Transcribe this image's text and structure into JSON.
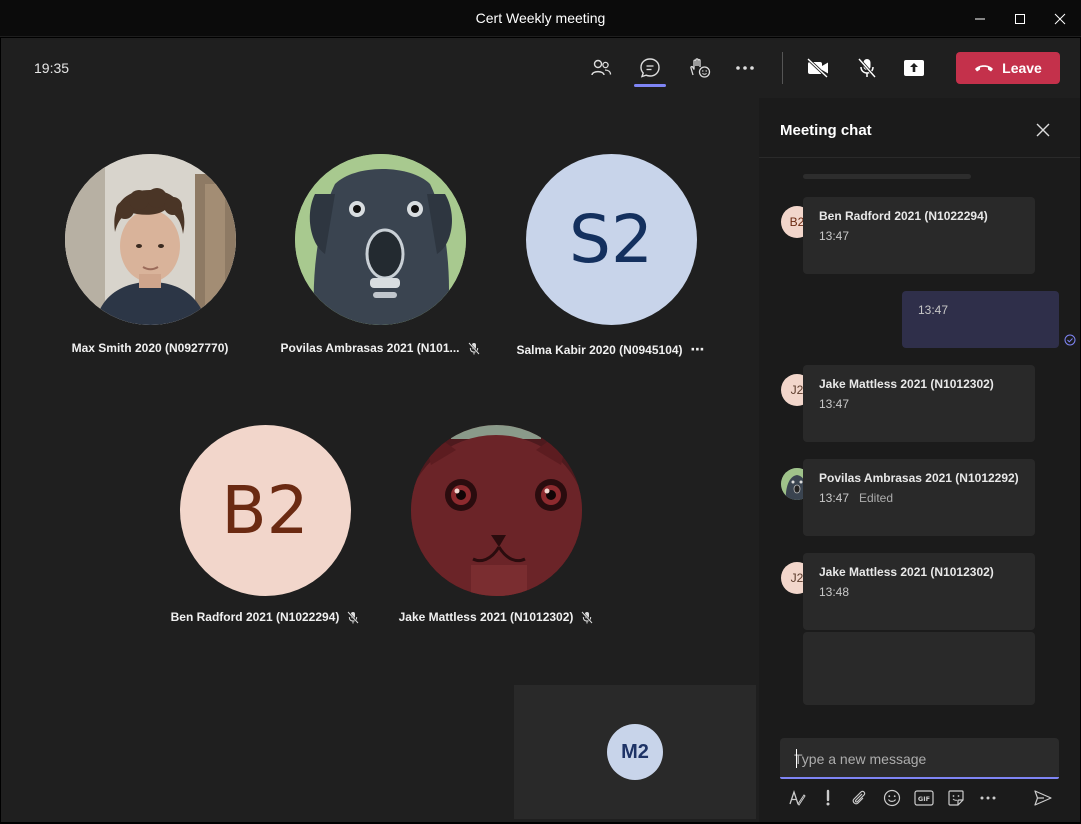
{
  "window": {
    "title": "Cert Weekly meeting"
  },
  "toolbar": {
    "time": "19:35",
    "leave_label": "Leave",
    "accent_color": "#7f85f5",
    "leave_color": "#c4314b"
  },
  "participants": [
    {
      "name": "Max Smith 2020 (N0927770)",
      "type": "photo"
    },
    {
      "name": "Povilas Ambrasas 2021 (N101...",
      "type": "photo",
      "muted": true
    },
    {
      "name": "Salma Kabir 2020 (N0945104)",
      "initials": "S2",
      "more": "⋯"
    },
    {
      "name": "Ben Radford 2021 (N1022294)",
      "initials": "B2",
      "muted": true
    },
    {
      "name": "Jake Mattless 2021 (N1012302)",
      "type": "photo",
      "muted": true
    }
  ],
  "self_tile": {
    "initials": "M2"
  },
  "chat": {
    "title": "Meeting chat",
    "messages": [
      {
        "avatar": "B2",
        "author": "Ben Radford 2021 (N1022294)",
        "time": "13:47"
      },
      {
        "mine": true,
        "time": "13:47"
      },
      {
        "avatar": "J2",
        "author": "Jake Mattless 2021 (N1012302)",
        "time": "13:47"
      },
      {
        "avatar": "photo",
        "author": "Povilas Ambrasas 2021 (N1012292)",
        "time": "13:47",
        "edited": "Edited"
      },
      {
        "avatar": "J2",
        "author": "Jake Mattless 2021 (N1012302)",
        "time": "13:48"
      }
    ],
    "compose_placeholder": "Type a new message"
  }
}
